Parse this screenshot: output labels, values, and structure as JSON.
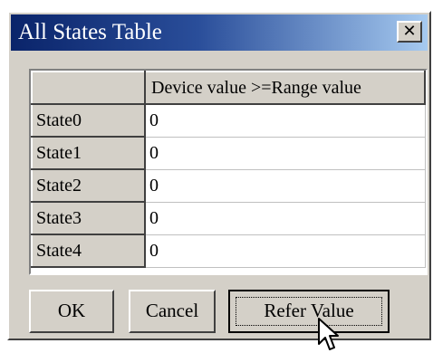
{
  "window": {
    "title": "All States Table",
    "close_glyph": "✕"
  },
  "table": {
    "column_header": "Device value >=Range value",
    "rows": [
      {
        "label": "State0",
        "value": "0"
      },
      {
        "label": "State1",
        "value": "0"
      },
      {
        "label": "State2",
        "value": "0"
      },
      {
        "label": "State3",
        "value": "0"
      },
      {
        "label": "State4",
        "value": "0"
      }
    ]
  },
  "buttons": {
    "ok": "OK",
    "cancel": "Cancel",
    "refer": "Refer Value"
  },
  "cursor": {
    "icon": "arrow-cursor-icon"
  }
}
